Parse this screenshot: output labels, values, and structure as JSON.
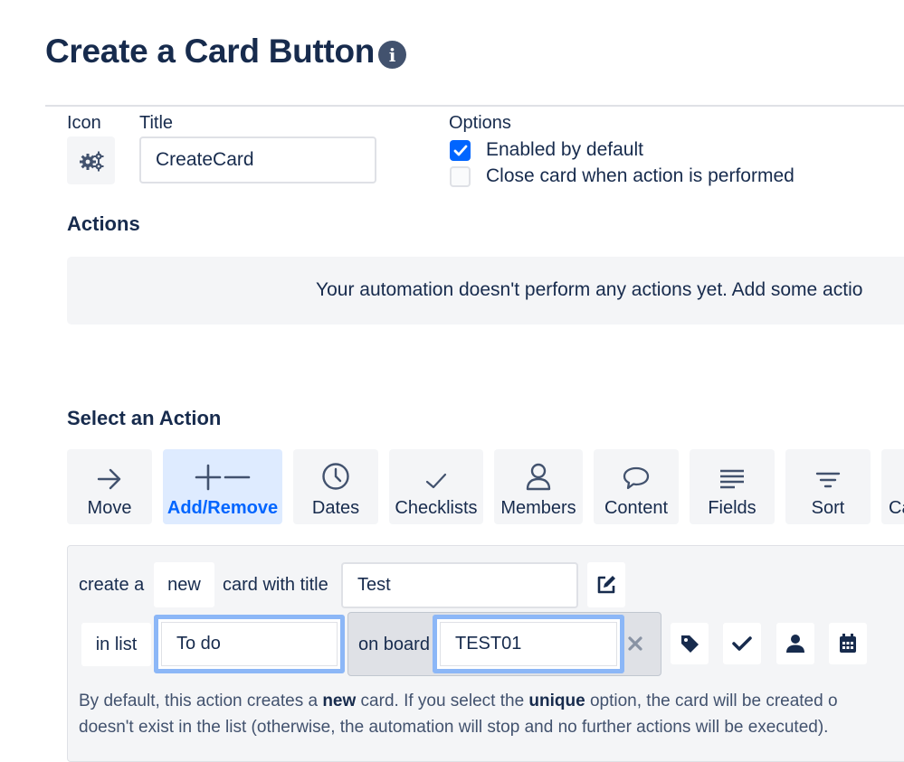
{
  "header": {
    "title": "Create a Card Button",
    "info_icon": "info-icon"
  },
  "form": {
    "icon_label": "Icon",
    "icon_name": "gears-icon",
    "title_label": "Title",
    "title_value": "CreateCard",
    "options_label": "Options",
    "options": [
      {
        "label": "Enabled by default",
        "checked": true
      },
      {
        "label": "Close card when action is performed",
        "checked": false
      }
    ]
  },
  "actions": {
    "heading": "Actions",
    "empty_message": "Your automation doesn't perform any actions yet. Add some actio"
  },
  "select_action": {
    "heading": "Select an Action",
    "tabs": [
      {
        "label": "Move",
        "icon": "arrow-right-icon",
        "active": false
      },
      {
        "label": "Add/Remove",
        "icon": "plus-minus-icon",
        "active": true
      },
      {
        "label": "Dates",
        "icon": "clock-icon",
        "active": false
      },
      {
        "label": "Checklists",
        "icon": "check-icon",
        "active": false
      },
      {
        "label": "Members",
        "icon": "person-icon",
        "active": false
      },
      {
        "label": "Content",
        "icon": "speech-bubble-icon",
        "active": false
      },
      {
        "label": "Fields",
        "icon": "lines-icon",
        "active": false
      },
      {
        "label": "Sort",
        "icon": "filter-icon",
        "active": false
      },
      {
        "label": "Ca",
        "icon": "",
        "active": false
      }
    ]
  },
  "builder": {
    "create_a": "create a",
    "new_chip": "new",
    "card_with_title": "card with title",
    "title_value": "Test",
    "in_list": "in list",
    "list_value": "To do",
    "on_board": "on board",
    "board_value": "TEST01",
    "clear_icon": "close-icon",
    "tool_icons": [
      "tag-icon",
      "check-icon",
      "person-icon",
      "calendar-icon"
    ],
    "help_line1": [
      "By default, this action creates a ",
      "new",
      " card. If you select the ",
      "unique",
      " option, the card will be created o"
    ],
    "help_line2": "doesn't exist in the list (otherwise, the automation will stop and no further actions will be executed)."
  },
  "colors": {
    "accent": "#0065ff",
    "text": "#172b4d",
    "panel": "#f4f5f7",
    "focus": "#8cb7f7"
  }
}
